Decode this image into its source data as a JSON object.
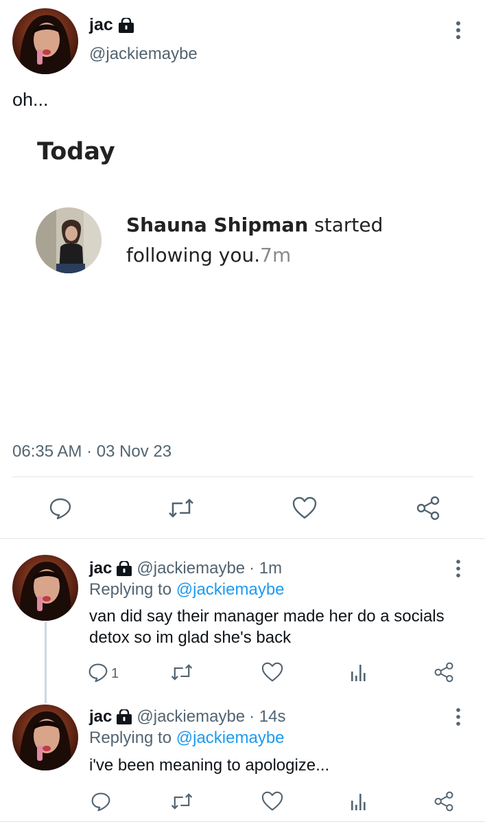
{
  "main_tweet": {
    "author_name": "jac",
    "author_handle": "@jackiemaybe",
    "text": "oh...",
    "timestamp": "06:35 AM · 03 Nov 23"
  },
  "embedded_screenshot": {
    "section_title": "Today",
    "notification_name": "Shauna Shipman",
    "notification_action_part1": " started",
    "notification_action_part2": "following you.",
    "notification_time": "7m"
  },
  "replies": [
    {
      "author_name": "jac",
      "author_handle": "@jackiemaybe",
      "time": "· 1m",
      "replying_prefix": "Replying to ",
      "replying_to": "@jackiemaybe",
      "text": "van did say their manager made her do a socials detox so im glad she's back",
      "reply_count": "1"
    },
    {
      "author_name": "jac",
      "author_handle": "@jackiemaybe",
      "time": "· 14s",
      "replying_prefix": "Replying to ",
      "replying_to": "@jackiemaybe",
      "text": "i've been meaning to apologize...",
      "reply_count": ""
    }
  ],
  "icons": {
    "reply": "reply-icon",
    "retweet": "retweet-icon",
    "like": "heart-icon",
    "views": "views-icon",
    "share": "share-icon",
    "more": "more-vertical-icon",
    "lock": "lock-icon"
  },
  "colors": {
    "text": "#0f1419",
    "secondary": "#536471",
    "link": "#1d9bf0",
    "divider": "#e1e5e8"
  }
}
